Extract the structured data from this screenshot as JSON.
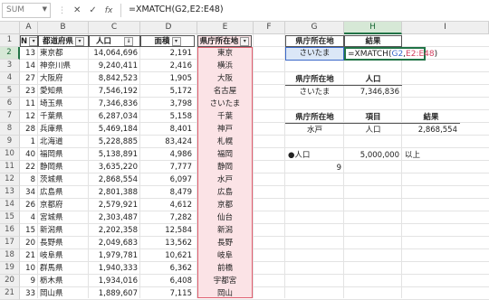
{
  "formula_bar": {
    "name_box": "SUM",
    "cancel_icon": "✕",
    "enter_icon": "✓",
    "fx_label": "fx",
    "formula": "=XMATCH(G2,E2:E48)"
  },
  "columns": [
    "A",
    "B",
    "C",
    "D",
    "E",
    "F",
    "G",
    "H",
    "I"
  ],
  "rows": [
    "1",
    "2",
    "3",
    "4",
    "5",
    "6",
    "7",
    "8",
    "9",
    "10",
    "11",
    "12",
    "13",
    "14",
    "15",
    "16",
    "17",
    "18",
    "19",
    "20",
    "21"
  ],
  "table": {
    "headers": {
      "n": "N",
      "pref": "都道府県",
      "pop": "人口",
      "area": "面積",
      "capital": "県庁所在地"
    },
    "records": [
      {
        "n": "13",
        "pref": "東京都",
        "pop": "14,064,696",
        "area": "2,191",
        "capital": "東京"
      },
      {
        "n": "14",
        "pref": "神奈川県",
        "pop": "9,240,411",
        "area": "2,416",
        "capital": "横浜"
      },
      {
        "n": "27",
        "pref": "大阪府",
        "pop": "8,842,523",
        "area": "1,905",
        "capital": "大阪"
      },
      {
        "n": "23",
        "pref": "愛知県",
        "pop": "7,546,192",
        "area": "5,172",
        "capital": "名古屋"
      },
      {
        "n": "11",
        "pref": "埼玉県",
        "pop": "7,346,836",
        "area": "3,798",
        "capital": "さいたま"
      },
      {
        "n": "12",
        "pref": "千葉県",
        "pop": "6,287,034",
        "area": "5,158",
        "capital": "千葉"
      },
      {
        "n": "28",
        "pref": "兵庫県",
        "pop": "5,469,184",
        "area": "8,401",
        "capital": "神戸"
      },
      {
        "n": "1",
        "pref": "北海道",
        "pop": "5,228,885",
        "area": "83,424",
        "capital": "札幌"
      },
      {
        "n": "40",
        "pref": "福岡県",
        "pop": "5,138,891",
        "area": "4,986",
        "capital": "福岡"
      },
      {
        "n": "22",
        "pref": "静岡県",
        "pop": "3,635,220",
        "area": "7,777",
        "capital": "静岡"
      },
      {
        "n": "8",
        "pref": "茨城県",
        "pop": "2,868,554",
        "area": "6,097",
        "capital": "水戸"
      },
      {
        "n": "34",
        "pref": "広島県",
        "pop": "2,801,388",
        "area": "8,479",
        "capital": "広島"
      },
      {
        "n": "26",
        "pref": "京都府",
        "pop": "2,579,921",
        "area": "4,612",
        "capital": "京都"
      },
      {
        "n": "4",
        "pref": "宮城県",
        "pop": "2,303,487",
        "area": "7,282",
        "capital": "仙台"
      },
      {
        "n": "15",
        "pref": "新潟県",
        "pop": "2,202,358",
        "area": "12,584",
        "capital": "新潟"
      },
      {
        "n": "20",
        "pref": "長野県",
        "pop": "2,049,683",
        "area": "13,562",
        "capital": "長野"
      },
      {
        "n": "21",
        "pref": "岐阜県",
        "pop": "1,979,781",
        "area": "10,621",
        "capital": "岐阜"
      },
      {
        "n": "10",
        "pref": "群馬県",
        "pop": "1,940,333",
        "area": "6,362",
        "capital": "前橋"
      },
      {
        "n": "9",
        "pref": "栃木県",
        "pop": "1,934,016",
        "area": "6,408",
        "capital": "宇都宮"
      },
      {
        "n": "33",
        "pref": "岡山県",
        "pop": "1,889,607",
        "area": "7,115",
        "capital": "岡山"
      }
    ]
  },
  "side": {
    "g1": "県庁所在地",
    "h1": "結果",
    "g2": "さいたま",
    "h2_prefix": "=XMATCH(",
    "h2_ref1": "G2",
    "h2_comma": ",",
    "h2_ref2": "E2:E48",
    "h2_suffix": ")",
    "g5": "県庁所在地",
    "h5": "人口",
    "g6": "さいたま",
    "h6": "7,346,836",
    "g8": "県庁所在地",
    "h8": "項目",
    "i8": "結果",
    "g9": "水戸",
    "h9": "人口",
    "i9": "2,868,554",
    "g11": "●人口",
    "h11": "5,000,000",
    "i11": "以上",
    "f12": "9"
  }
}
